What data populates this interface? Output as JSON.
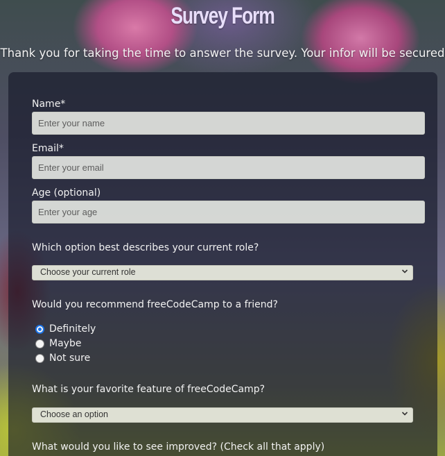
{
  "header": {
    "title": "Survey Form",
    "description": "Thank you for taking the time to answer the survey. Your infor will be secured"
  },
  "form": {
    "name": {
      "label": "Name*",
      "placeholder": "Enter your name"
    },
    "email": {
      "label": "Email*",
      "placeholder": "Enter your email"
    },
    "age": {
      "label": "Age (optional)",
      "placeholder": "Enter your age"
    },
    "role": {
      "question": "Which option best describes your current role?",
      "selected": "Choose your current role"
    },
    "recommend": {
      "question": "Would you recommend freeCodeCamp to a friend?",
      "options": [
        {
          "label": "Definitely",
          "checked": true
        },
        {
          "label": "Maybe",
          "checked": false
        },
        {
          "label": "Not sure",
          "checked": false
        }
      ]
    },
    "feature": {
      "question": "What is your favorite feature of freeCodeCamp?",
      "selected": "Choose an option"
    },
    "improve": {
      "question": "What would you like to see improved? (Check all that apply)"
    }
  },
  "icons": {
    "dropdown": "chevron-down-icon",
    "radio_accent": "#1a73e8"
  }
}
